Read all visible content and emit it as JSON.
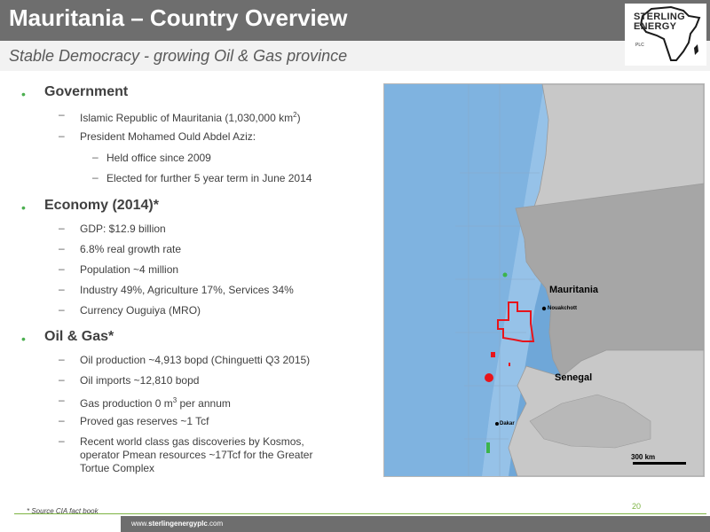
{
  "header": {
    "title": "Mauritania – Country Overview",
    "subtitle": "Stable Democracy - growing Oil & Gas province"
  },
  "logo": {
    "line1": "STERLING",
    "line2": "ENERGY",
    "line3": "PLC",
    "icon": "africa-map-icon"
  },
  "sections": {
    "government": {
      "heading": "Government",
      "items": [
        "Islamic Republic of Mauritania (1,030,000 km",
        "President Mohamed Ould Abdel Aziz:"
      ],
      "area_sup": "2",
      "area_close": ")",
      "subitems": [
        "Held office since 2009",
        "Elected for further 5 year term in June 2014"
      ]
    },
    "economy": {
      "heading": "Economy (2014)*",
      "items": [
        "GDP: $12.9 billion",
        "6.8% real growth rate",
        "Population ~4 million",
        "Industry 49%, Agriculture 17%, Services 34%",
        "Currency Ouguiya (MRO)"
      ]
    },
    "oil_gas": {
      "heading": "Oil & Gas*",
      "items": [
        "Oil production ~4,913 bopd (Chinguetti Q3 2015)",
        "Oil imports ~12,810 bopd",
        "Gas production 0 m",
        "Proved gas reserves ~1 Tcf"
      ],
      "gas_sup": "3",
      "gas_tail": " per annum",
      "discoveries_lines": [
        "Recent world class gas discoveries by Kosmos,",
        "operator Pmean resources ~17Tcf for the Greater",
        "Tortue Complex"
      ]
    }
  },
  "map": {
    "country_label": "Mauritania",
    "capital_label": "Nouakchott",
    "neighbor_label": "Senegal",
    "dakar_label": "Dakar",
    "scale_label": "300 km",
    "colors": {
      "ocean": "#6fa7d8",
      "land": "#a6a6a6",
      "licence": "#e8141b",
      "discovery": "#3cb44b"
    }
  },
  "footer": {
    "footnote": "* Source CIA fact book",
    "page_number": "20",
    "url_prefix": "www.",
    "url_brand": "sterlingenergyplc",
    "url_suffix": ".com"
  },
  "colors": {
    "bullet": "#4caf50",
    "header_bg": "#6e6e6e",
    "accent": "#7cb342"
  }
}
